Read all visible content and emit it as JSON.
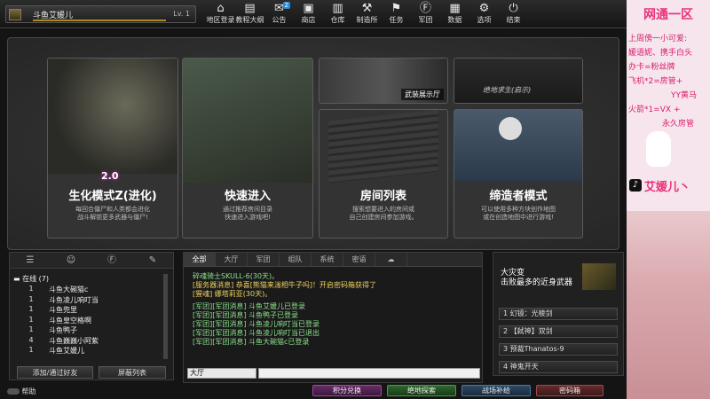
{
  "player": {
    "name": "斗鱼艾媛儿",
    "level": "Lv. 1"
  },
  "nav": [
    {
      "label": "地区登录",
      "icon": "⌂"
    },
    {
      "label": "教程大纲",
      "icon": "▤"
    },
    {
      "label": "公告",
      "icon": "✉",
      "badge": "2"
    },
    {
      "label": "商店",
      "icon": "▣"
    },
    {
      "label": "仓库",
      "icon": "▥"
    },
    {
      "label": "制造所",
      "icon": "⚒"
    },
    {
      "label": "任务",
      "icon": "⚑"
    },
    {
      "label": "军团",
      "icon": "Ⓕ"
    },
    {
      "label": "数据",
      "icon": "▦"
    },
    {
      "label": "选项",
      "icon": "⚙"
    },
    {
      "label": "结束",
      "icon": "⏻"
    }
  ],
  "modes": {
    "zombie": {
      "title": "生化模式Z(进化)",
      "badge": "2.0",
      "desc": "每回合僵尸和人类都会进化\n战斗解锁更多武器与僵尸!"
    },
    "quick": {
      "title": "快速进入",
      "desc": "通过推荐房间目录\n快速进入游戏吧!"
    },
    "armory": {
      "tag": "武装展示厅"
    },
    "unknown": {
      "tag": "绝地求生(启示)"
    },
    "rooms": {
      "title": "房间列表",
      "desc": "搜索想要进入的房间或\n自己创建房间参加游戏。"
    },
    "creator": {
      "title": "缔造者模式",
      "desc": "可以使用多种方块创作地图\n或在创造地图中进行游戏!"
    }
  },
  "friends": {
    "online_label": "在线 (7)",
    "list": [
      {
        "n": "1",
        "name": "斗鱼大碗猫c"
      },
      {
        "n": "1",
        "name": "斗鱼凌儿响叮当"
      },
      {
        "n": "1",
        "name": "斗鱼兜里"
      },
      {
        "n": "1",
        "name": "斗鱼皇空格啊"
      },
      {
        "n": "1",
        "name": "斗鱼鸭子"
      },
      {
        "n": "4",
        "name": "斗鱼巍巍小阿紫"
      },
      {
        "n": "1",
        "name": "斗鱼艾媛儿"
      }
    ],
    "add_button": "添加/通过好友",
    "block_button": "屏蔽列表"
  },
  "chat": {
    "tabs": [
      "全部",
      "大厅",
      "军团",
      "组队",
      "系统",
      "密语"
    ],
    "messages": [
      {
        "text": "碎魂骑士SKULL-6(30天)。",
        "color": "#8ce08c"
      },
      {
        "text": "[服务器消息] 恭喜[熊猫来湍相牛子吗]！开启密码箱获得了",
        "color": "#f0d060"
      },
      {
        "text": "[猩魂] 娜塔莉亚(30天)。",
        "color": "#f0d060"
      },
      {
        "text": "[军团][军团消息] 斗鱼艾媛儿已登录",
        "color": "#8ce08c"
      },
      {
        "text": "[军团][军团消息] 斗鱼鸭子已登录",
        "color": "#8ce08c"
      },
      {
        "text": "[军团][军团消息] 斗鱼凌儿响叮当已登录",
        "color": "#8ce08c"
      },
      {
        "text": "[军团][军团消息] 斗鱼凌儿响叮当已退出",
        "color": "#8ce08c"
      },
      {
        "text": "[军团][军团消息] 斗鱼大碗猫c已登录",
        "color": "#8ce08c"
      }
    ],
    "channel": "大厅"
  },
  "event": {
    "title_line1": "大灾变",
    "title_line2": "击败最多的近身武器",
    "items": [
      "1 幻镜：光棱剑",
      "2 【弑神】双剑",
      "3 预裁Thanatos-9",
      "4 神鬼开天"
    ]
  },
  "bottom": {
    "help": "帮助",
    "points": "积分兑换",
    "pubg": "绝地探索",
    "supply": "战场补给",
    "box": "密码箱"
  },
  "stream": {
    "header": "网通一区",
    "lines": [
      "上周傍一小可爱:",
      "媛语妮、携手白头",
      "办卡=粉丝牌",
      "飞机*2=房管+",
      "YY黄马",
      "火箭*1=VX +",
      "永久房管"
    ],
    "handle": "艾媛儿丶"
  }
}
